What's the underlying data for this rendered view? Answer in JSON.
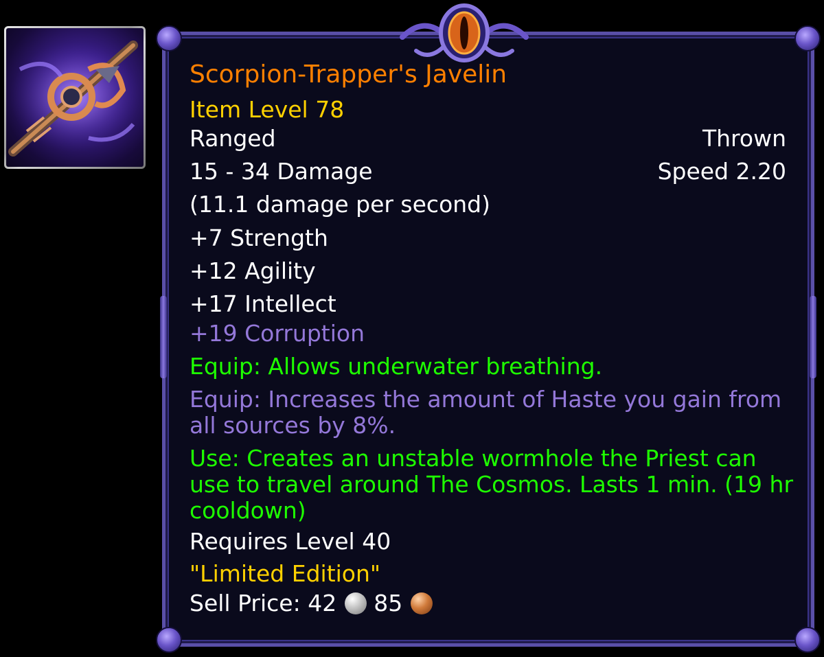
{
  "item": {
    "name": "Scorpion-Trapper's Javelin",
    "item_level": "Item Level 78",
    "slot": "Ranged",
    "type": "Thrown",
    "damage": "15 - 34 Damage",
    "speed": "Speed 2.20",
    "dps": "(11.1 damage per second)",
    "stats": [
      "+7 Strength",
      "+12 Agility",
      "+17 Intellect"
    ],
    "corruption": "+19 Corruption",
    "equip_1": "Equip: Allows underwater breathing.",
    "equip_2": "Equip: Increases the amount of Haste you gain from all sources by 8%.",
    "use": "Use: Creates an unstable wormhole the Priest can use to travel around The Cosmos. Lasts 1 min. (19 hr cooldown)",
    "requires": "Requires Level 40",
    "flavor": "\"Limited Edition\"",
    "sell_label": "Sell Price:",
    "sell_silver": "42",
    "sell_copper": "85"
  },
  "colors": {
    "name": "#ff8000",
    "item_level": "#ffd100",
    "normal": "#ffffff",
    "corruption": "#9478d9",
    "green_effect": "#1eff00"
  },
  "icons": {
    "item_icon": "javelin-icon",
    "ornament": "eye-ornament-icon",
    "silver": "silver-coin-icon",
    "copper": "copper-coin-icon"
  }
}
